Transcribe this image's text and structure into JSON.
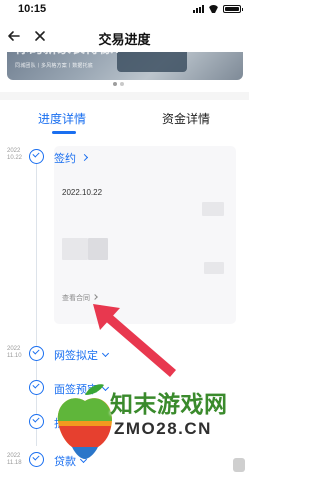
{
  "status_bar": {
    "time": "10:15"
  },
  "nav": {
    "title": "交易进度"
  },
  "banner": {
    "title": "你的新家长得像?",
    "subtitle": "同城团队丨多风格方案丨数据托底",
    "dots": 2,
    "active_dot": 0
  },
  "tabs": [
    {
      "label": "进度详情",
      "active": true
    },
    {
      "label": "资金详情",
      "active": false
    }
  ],
  "steps": [
    {
      "date_line1": "2022",
      "date_line2": "10.22",
      "label": "签约",
      "expanded": true
    },
    {
      "date_line1": "2022",
      "date_line2": "11.10",
      "label": "网签拟定",
      "expanded": false
    },
    {
      "date_line1": "",
      "date_line2": "",
      "label": "面签预审",
      "expanded": false
    },
    {
      "date_line1": "",
      "date_line2": "",
      "label": "批贷",
      "expanded": false
    },
    {
      "date_line1": "2022",
      "date_line2": "11.18",
      "label": "贷款",
      "expanded": false
    }
  ],
  "contract_card": {
    "date": "2022.10.22",
    "view_contract": "查看合同"
  },
  "watermark": {
    "title": "知末游戏网",
    "url": "ZMO28.CN"
  },
  "colors": {
    "accent": "#1a6ff0",
    "arrow": "#e8384f"
  }
}
